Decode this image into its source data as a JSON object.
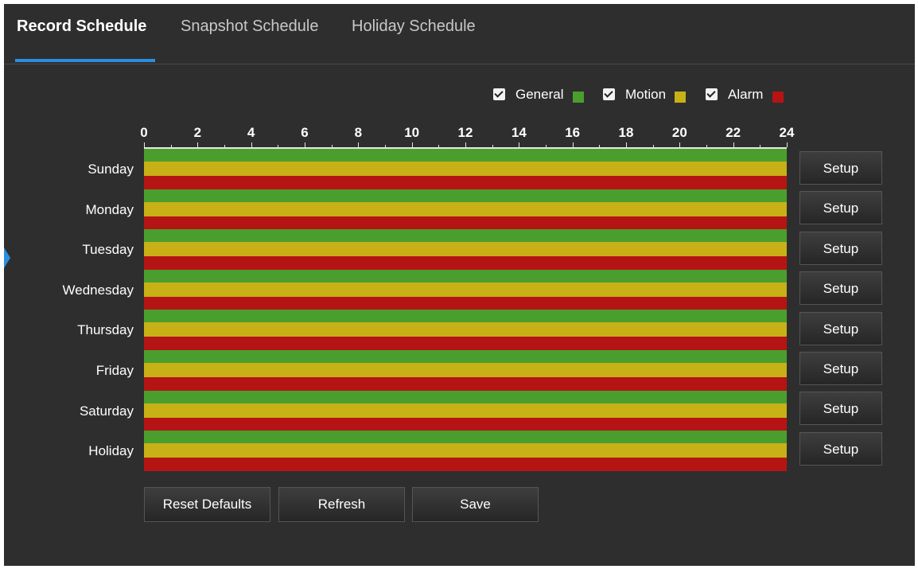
{
  "tabs": [
    {
      "label": "Record Schedule",
      "active": true
    },
    {
      "label": "Snapshot Schedule",
      "active": false
    },
    {
      "label": "Holiday Schedule",
      "active": false
    }
  ],
  "legend": [
    {
      "label": "General",
      "checked": true,
      "color": "#4a9e2e"
    },
    {
      "label": "Motion",
      "checked": true,
      "color": "#c8b017"
    },
    {
      "label": "Alarm",
      "checked": true,
      "color": "#b51414"
    }
  ],
  "hours": [
    "0",
    "2",
    "4",
    "6",
    "8",
    "10",
    "12",
    "14",
    "16",
    "18",
    "20",
    "22",
    "24"
  ],
  "days": [
    {
      "label": "Sunday",
      "setup_label": "Setup"
    },
    {
      "label": "Monday",
      "setup_label": "Setup"
    },
    {
      "label": "Tuesday",
      "setup_label": "Setup"
    },
    {
      "label": "Wednesday",
      "setup_label": "Setup"
    },
    {
      "label": "Thursday",
      "setup_label": "Setup"
    },
    {
      "label": "Friday",
      "setup_label": "Setup"
    },
    {
      "label": "Saturday",
      "setup_label": "Setup"
    },
    {
      "label": "Holiday",
      "setup_label": "Setup"
    }
  ],
  "buttons": {
    "reset_label": "Reset Defaults",
    "refresh_label": "Refresh",
    "save_label": "Save"
  }
}
